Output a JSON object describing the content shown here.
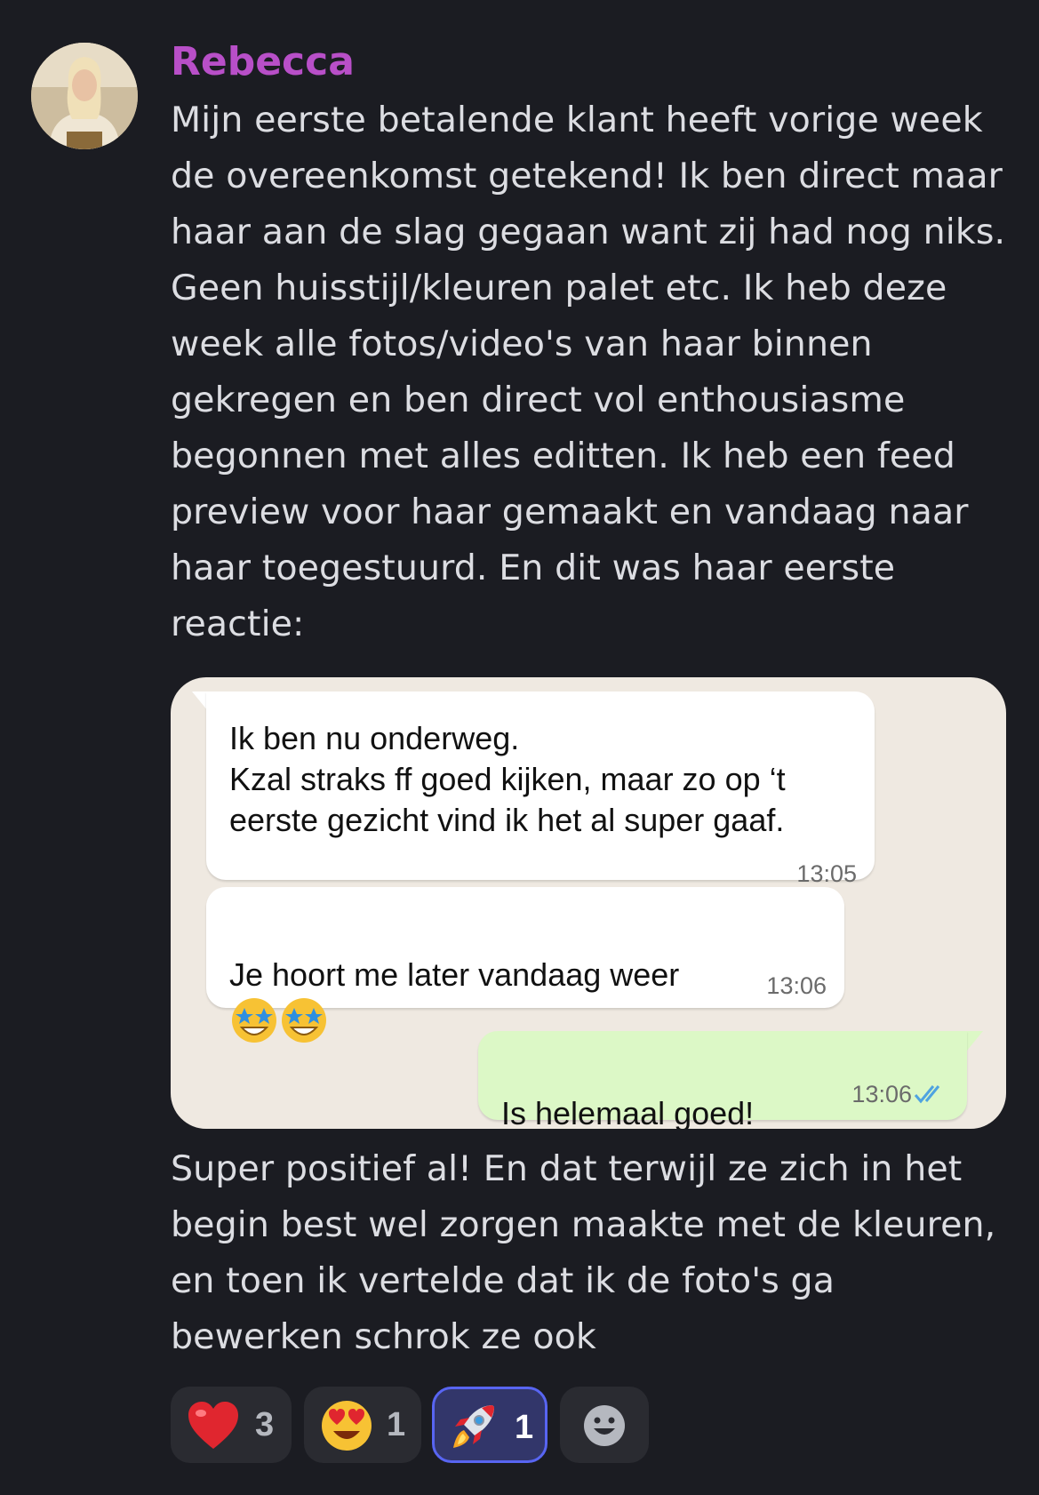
{
  "message": {
    "author": "Rebecca",
    "paragraph1": "Mijn eerste betalende klant heeft vorige week\nde overeenkomst getekend! Ik ben direct maar\nhaar aan de slag gegaan want zij had nog niks.\nGeen huisstijl/kleuren palet etc. Ik heb deze\nweek alle fotos/video's van haar binnen\ngekregen en ben direct vol enthousiasme\nbegonnen met alles editten. Ik heb een feed\npreview voor haar gemaakt en vandaag naar\nhaar toegestuurd. En dit was haar eerste\nreactie:",
    "paragraph2": "Super positief al! En dat terwijl ze zich in het\nbegin best wel zorgen maakte met de kleuren,\nen toen ik vertelde dat ik de foto's ga\nbewerken schrok ze ook"
  },
  "embed": {
    "bubbles": [
      {
        "text": "Ik ben nu onderweg.\nKzal straks ff goed kijken, maar zo op ‘t\neerste gezicht vind ik het al super gaaf.",
        "time": "13:05"
      },
      {
        "text": "Je hoort me later vandaag weer",
        "time": "13:06"
      },
      {
        "text": "Is helemaal goed!",
        "time": "13:06"
      }
    ],
    "colors": {
      "incoming": "#ffffff",
      "outgoing": "#dcf8c6",
      "read_ticks": "#4fa3e0"
    }
  },
  "reactions": [
    {
      "icon": "red-heart-icon",
      "count": "3"
    },
    {
      "icon": "heart-eyes-icon",
      "count": "1"
    },
    {
      "icon": "rocket-icon",
      "count": "1",
      "active": true
    },
    {
      "icon": "add-reaction-icon"
    }
  ],
  "accent": {
    "author_color": "#b84fc8",
    "active_reaction_border": "#5865f2"
  }
}
